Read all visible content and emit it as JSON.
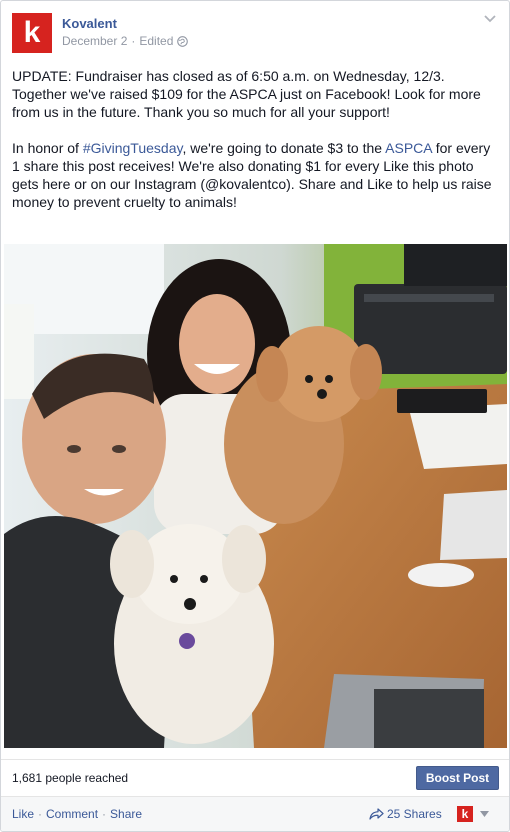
{
  "post": {
    "page_name": "Kovalent",
    "date": "December 2",
    "edited": "Edited",
    "meta_separator": "·",
    "logo_letter": "k",
    "paragraph1": "UPDATE: Fundraiser has closed as of 6:50 a.m. on Wednesday, 12/3. Together we've raised $109 for the ASPCA just on Facebook! Look for more from us in the future. Thank you so much for all your support!",
    "p2_before": "In honor of ",
    "p2_hashtag": "#GivingTuesday",
    "p2_middle": ", we're going to donate $3 to the ",
    "p2_aspca": "ASPCA",
    "p2_after": " for every 1 share this post receives! We're also donating $1 for every Like this photo gets here or on our Instagram (@kovalentco). Share and Like to help us raise money to prevent cruelty to animals!"
  },
  "stats": {
    "reach": "1,681 people reached",
    "boost_label": "Boost Post"
  },
  "actions": {
    "like": "Like",
    "comment": "Comment",
    "share": "Share",
    "separator": "·",
    "shares_count": "25 Shares"
  },
  "icons": {
    "privacy": "globe-icon",
    "options": "chevron-down-icon",
    "shares": "share-arrow-icon",
    "switcher": "caret-down-icon"
  },
  "colors": {
    "brand_red": "#d6231f",
    "link_blue": "#3b5998",
    "boost_blue": "#4e69a2",
    "meta_gray": "#9197a3"
  }
}
